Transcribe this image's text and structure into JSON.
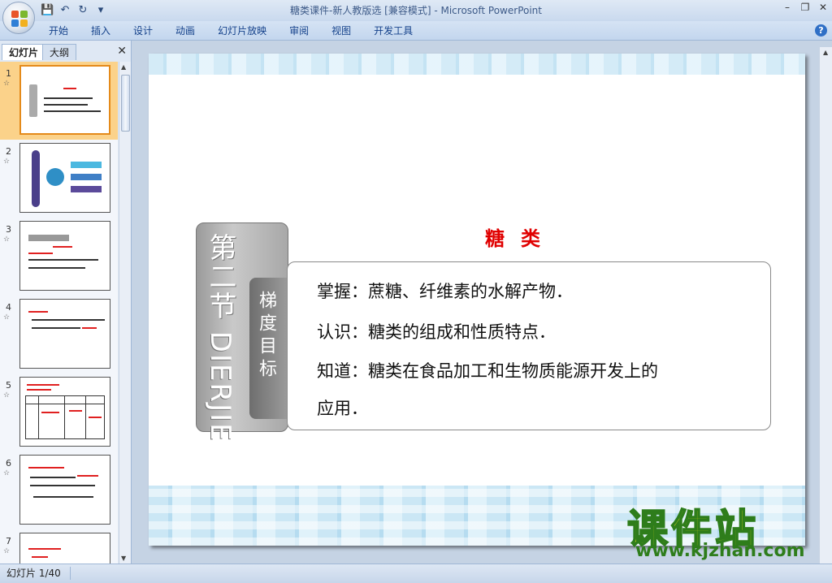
{
  "window": {
    "title": "糖类课件-新人教版选 [兼容模式] - Microsoft PowerPoint",
    "controls": [
      "–",
      "❐",
      "✕"
    ]
  },
  "qat": {
    "save": "💾",
    "undo": "↶",
    "redo": "↻",
    "more": "▾"
  },
  "ribbon": {
    "tabs": [
      "开始",
      "插入",
      "设计",
      "动画",
      "幻灯片放映",
      "审阅",
      "视图",
      "开发工具"
    ],
    "help": "?"
  },
  "left_pane": {
    "tabs": {
      "slides": "幻灯片",
      "outline": "大纲"
    },
    "close": "✕",
    "thumbnails": [
      {
        "num": "1",
        "selected": true
      },
      {
        "num": "2",
        "selected": false
      },
      {
        "num": "3",
        "selected": false
      },
      {
        "num": "4",
        "selected": false
      },
      {
        "num": "5",
        "selected": false
      },
      {
        "num": "6",
        "selected": false
      },
      {
        "num": "7",
        "selected": false
      }
    ],
    "star": "☆"
  },
  "slide": {
    "section": "第二节 DIERJIE",
    "goal_label": "梯度目标",
    "title": "糖类",
    "bullets": [
      "掌握：蔗糖、纤维素的水解产物．",
      "认识：糖类的组成和性质特点．",
      "知道：糖类在食品加工和生物质能源开发上的",
      "应用．"
    ]
  },
  "watermark": {
    "main": "课件站",
    "url": "www.kjzhan.com"
  },
  "status": {
    "slide_info": "幻灯片 1/40"
  },
  "colors": {
    "title_red": "#e00000",
    "accent_orange": "#fbd28a",
    "ribbon_text": "#15428b"
  }
}
